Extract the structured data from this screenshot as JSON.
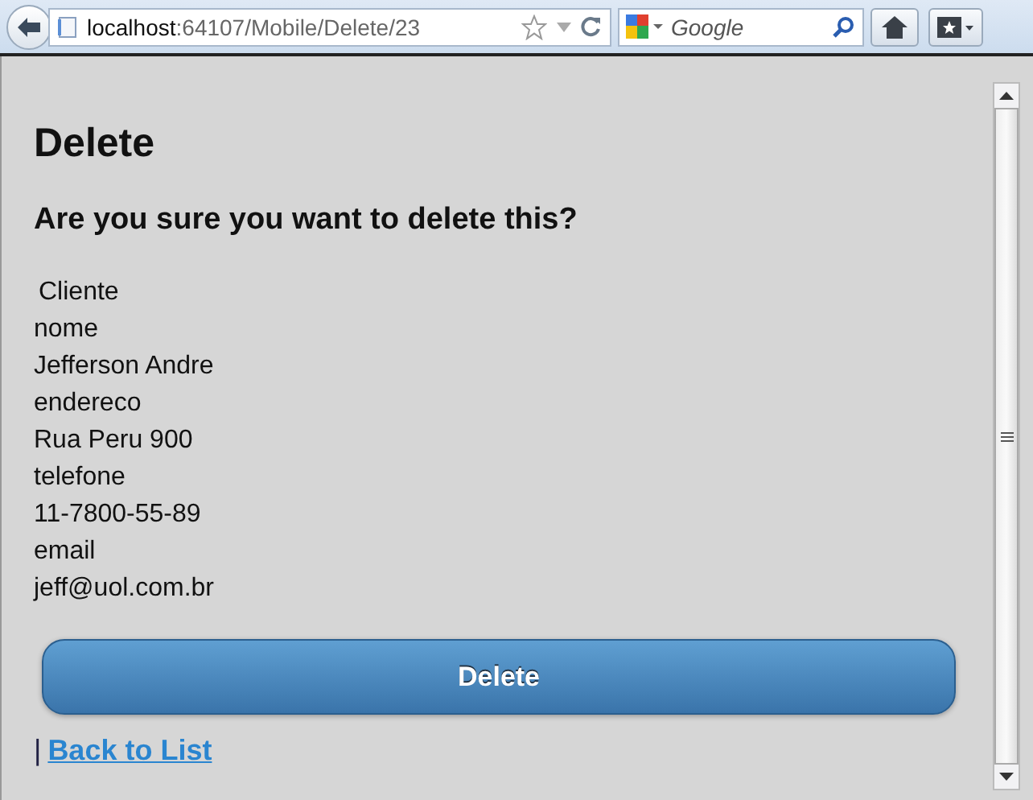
{
  "browser": {
    "url_host": "localhost",
    "url_path": ":64107/Mobile/Delete/23",
    "search_placeholder": "Google"
  },
  "page": {
    "title": "Delete",
    "question": "Are you sure you want to delete this?",
    "legend": "Cliente",
    "fields": [
      {
        "label": "nome",
        "value": "Jefferson Andre"
      },
      {
        "label": "endereco",
        "value": "Rua Peru 900"
      },
      {
        "label": "telefone",
        "value": "11-7800-55-89"
      },
      {
        "label": "email",
        "value": "jeff@uol.com.br"
      }
    ],
    "button": "Delete",
    "separator": "|",
    "link": "Back to List"
  }
}
